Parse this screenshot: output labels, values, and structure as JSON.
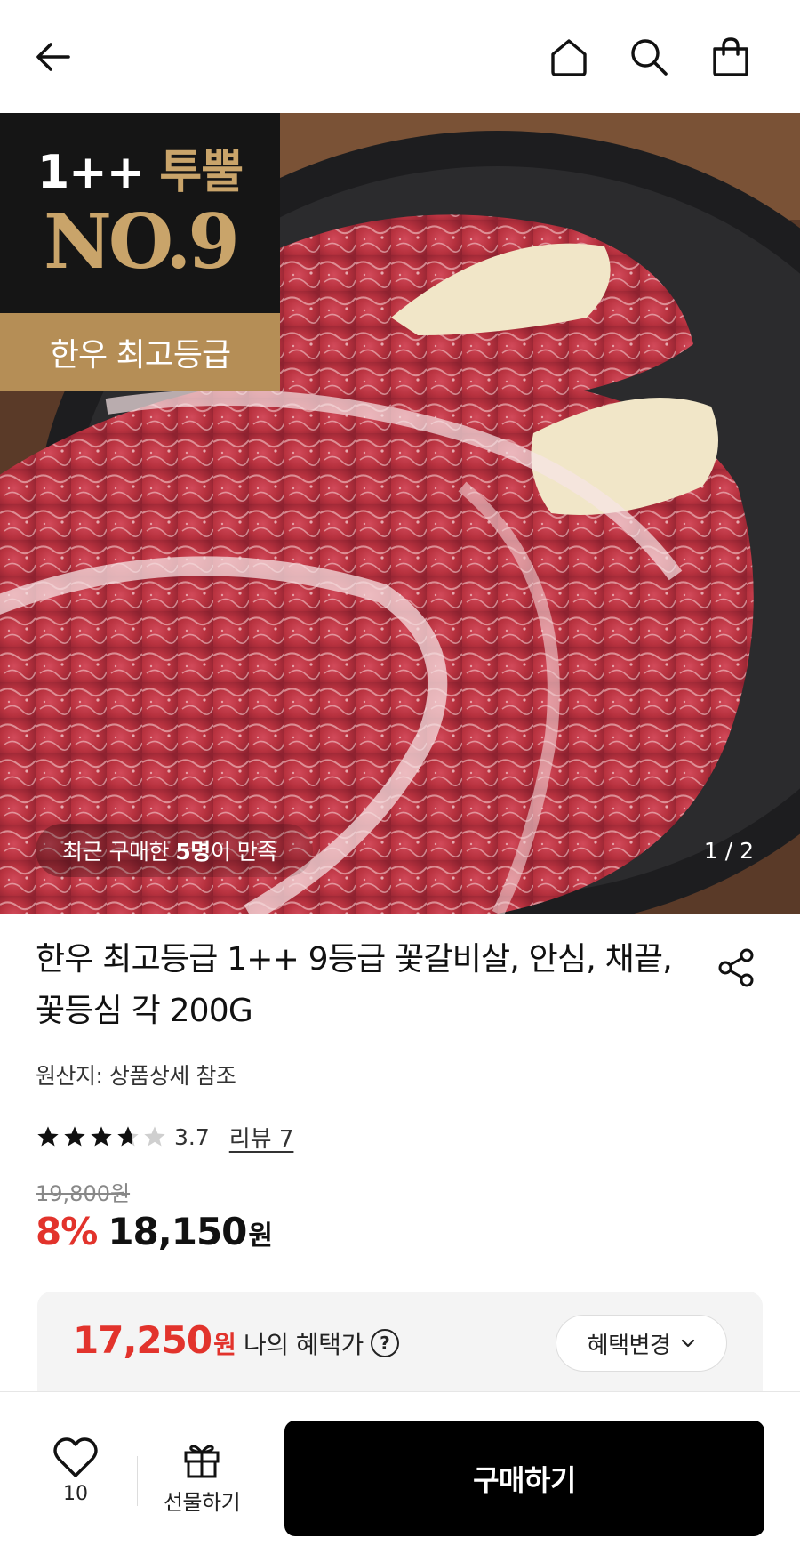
{
  "header": {
    "back_icon": "arrow-left-icon",
    "home_icon": "home-icon",
    "search_icon": "search-icon",
    "cart_icon": "shopping-bag-icon"
  },
  "hero": {
    "badge_grade": "1++",
    "badge_grade_word": "투뿔",
    "badge_rank": "NO.9",
    "badge_tagline": "한우 최고등급",
    "satisfaction_prefix": "최근 구매한",
    "satisfaction_count": "5명",
    "satisfaction_suffix": "이 만족",
    "pager": "1 / 2",
    "pager_current": 1,
    "pager_total": 2
  },
  "product": {
    "title": "한우 최고등급 1++ 9등급 꽃갈비살, 안심, 채끝, 꽃등심 각 200G",
    "origin": "원산지: 상품상세 참조",
    "rating": "3.7",
    "rating_value": 3.7,
    "rating_max": 5,
    "review_link": "리뷰 7",
    "original_price": "19,800원",
    "discount": "8%",
    "price": "18,150",
    "price_unit": "원",
    "share_icon": "share-icon"
  },
  "benefit": {
    "price": "17,250",
    "price_unit": "원",
    "label": "나의 혜택가",
    "help": "?",
    "change_label": "혜택변경"
  },
  "bottom": {
    "like_count": "10",
    "gift_label": "선물하기",
    "buy_label": "구매하기"
  },
  "colors": {
    "accent_red": "#e2332c",
    "badge_gold": "#b58e56",
    "gold_text": "#c9a46a",
    "buy_button": "#000000"
  }
}
